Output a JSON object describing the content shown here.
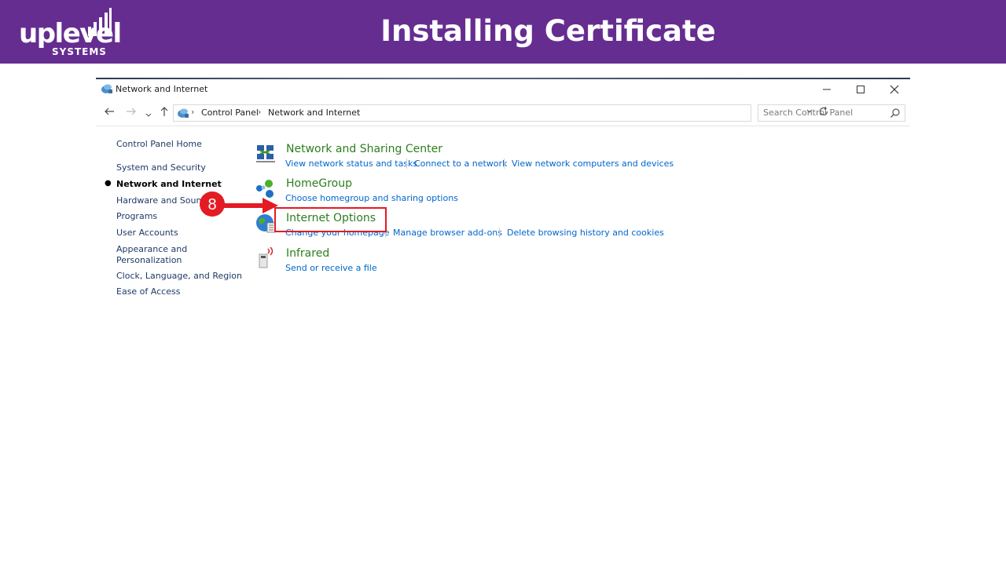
{
  "slide": {
    "title": "Installing Certificate",
    "logo_text": "uplevel",
    "logo_sub": "SYSTEMS"
  },
  "window": {
    "title": "Network and Internet",
    "minimize_icon": "minimize-icon",
    "maximize_icon": "maximize-icon",
    "close_icon": "close-icon"
  },
  "address": {
    "crumbs": [
      "Control Panel",
      "Network and Internet"
    ],
    "search_placeholder": "Search Control Panel"
  },
  "left_pane": {
    "items": [
      "Control Panel Home",
      "System and Security",
      "Network and Internet",
      "Hardware and Sound",
      "Programs",
      "User Accounts",
      "Appearance and",
      "Personalization",
      "Clock, Language, and Region",
      "Ease of Access"
    ],
    "active": "Network and Internet"
  },
  "categories": [
    {
      "title": "Network and Sharing Center",
      "icon": "network-sharing-icon",
      "links": [
        "View network status and tasks",
        "Connect to a network",
        "View network computers and devices"
      ]
    },
    {
      "title": "HomeGroup",
      "icon": "homegroup-icon",
      "links": [
        "Choose homegroup and sharing options"
      ]
    },
    {
      "title": "Internet Options",
      "icon": "internet-options-icon",
      "links": [
        "Change your homepage",
        "Manage browser add-ons",
        "Delete browsing history and cookies"
      ]
    },
    {
      "title": "Infrared",
      "icon": "infrared-icon",
      "links": [
        "Send or receive a file"
      ]
    }
  ],
  "annotation": {
    "step_number": "8",
    "color": "#e31b23"
  },
  "colors": {
    "header_bg": "#662d91",
    "category_title": "#2d7d1e",
    "link": "#0066cc"
  }
}
